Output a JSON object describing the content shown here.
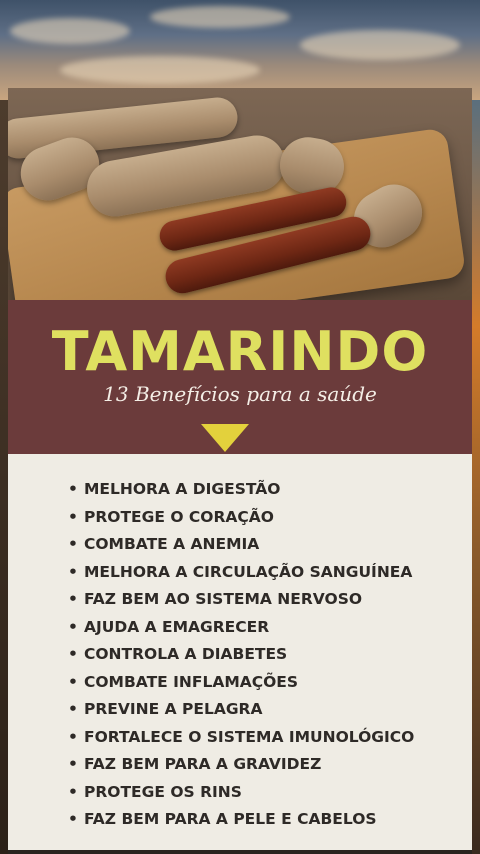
{
  "banner": {
    "title": "TAMARINDO",
    "subtitle": "13 Benefícios para a saúde",
    "accent_color": "#dfe060",
    "background_color": "#6b3b3b"
  },
  "photo": {
    "subject": "tamarind-pods-on-cutting-board"
  },
  "benefits": [
    "MELHORA A DIGESTÃO",
    "PROTEGE O CORAÇÃO",
    "COMBATE A ANEMIA",
    "MELHORA A CIRCULAÇÃO SANGUÍNEA",
    "FAZ BEM AO SISTEMA NERVOSO",
    "AJUDA A EMAGRECER",
    "CONTROLA A DIABETES",
    "COMBATE INFLAMAÇÕES",
    "PREVINE A PELAGRA",
    "FORTALECE O SISTEMA IMUNOLÓGICO",
    "FAZ BEM PARA A GRAVIDEZ",
    "PROTEGE OS RINS",
    "FAZ BEM PARA A PELE E CABELOS"
  ]
}
